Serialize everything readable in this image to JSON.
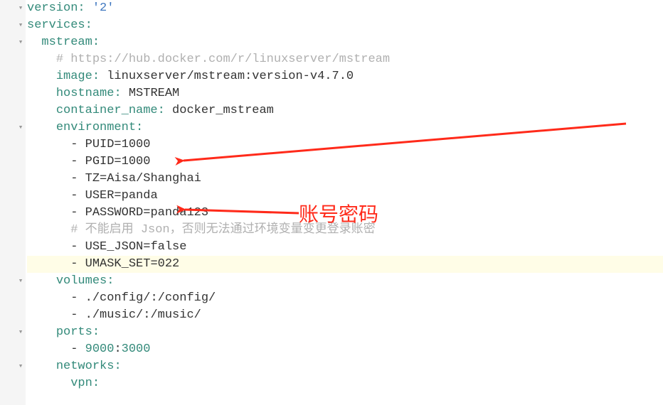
{
  "gutter": [
    "",
    "",
    "",
    "",
    "",
    "",
    "",
    "",
    "",
    "",
    "",
    "",
    "",
    "",
    "",
    "",
    "",
    "",
    "",
    "",
    "",
    "",
    ""
  ],
  "fold": [
    "▾",
    "▾",
    "▾",
    "",
    "",
    "",
    "",
    "▾",
    "",
    "",
    "",
    "",
    "",
    "",
    "",
    "",
    "▾",
    "",
    "",
    "▾",
    "",
    "▾",
    ""
  ],
  "code": {
    "l1_key": "version",
    "l1_val": "'2'",
    "l2_key": "services",
    "l3_key": "mstream",
    "l4_comment": "# https://hub.docker.com/r/linuxserver/mstream",
    "l5_key": "image",
    "l5_val": "linuxserver/mstream:version-v4.7.0",
    "l6_key": "hostname",
    "l6_val": "MSTREAM",
    "l7_key": "container_name",
    "l7_val": "docker_mstream",
    "l8_key": "environment",
    "l9": "PUID=1000",
    "l10": "PGID=1000",
    "l11": "TZ=Aisa/Shanghai",
    "l12": "USER=panda",
    "l13": "PASSWORD=panda123",
    "l14_comment": "# 不能启用 Json，否则无法通过环境变量变更登录账密",
    "l15": "USE_JSON=false",
    "l16": "UMASK_SET=022",
    "l17_key": "volumes",
    "l18": "./config/:/config/",
    "l19": "./music/:/music/",
    "l20_key": "ports",
    "l21_a": "9000",
    "l21_b": "3000",
    "l22_key": "networks",
    "l23_key": "vpn"
  },
  "annotation": {
    "label": "账号密码",
    "arrow_color": "#ff2a1a"
  }
}
